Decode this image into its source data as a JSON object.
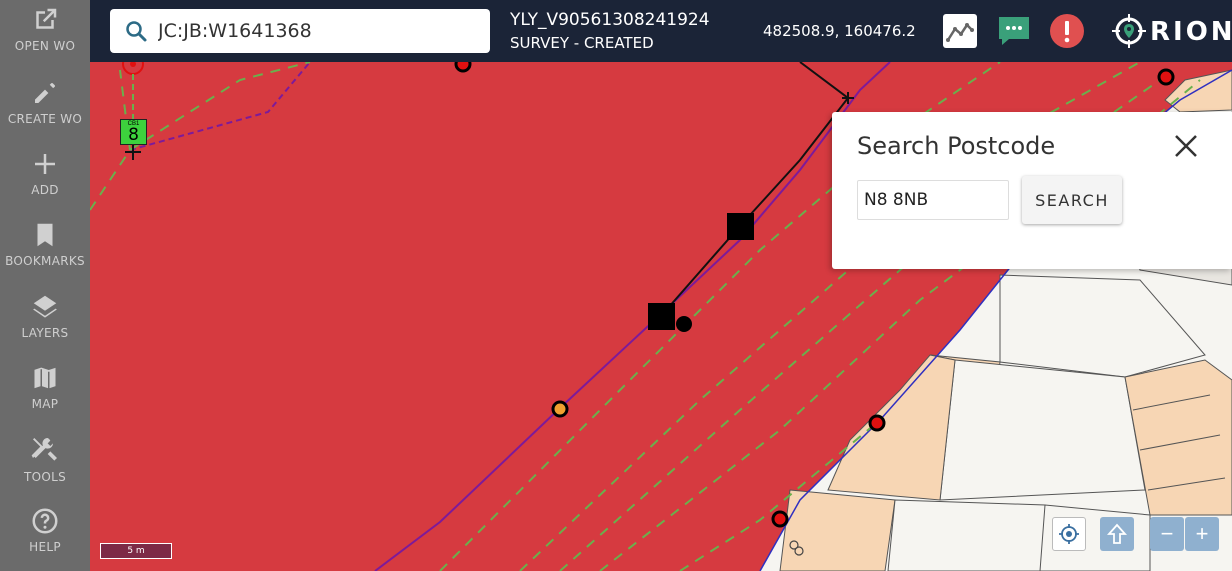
{
  "sidebar": {
    "items": [
      {
        "label": "OPEN WO",
        "icon": "open-external-icon"
      },
      {
        "label": "CREATE WO",
        "icon": "pencil-icon"
      },
      {
        "label": "ADD",
        "icon": "plus-icon"
      },
      {
        "label": "BOOKMARKS",
        "icon": "bookmark-icon"
      },
      {
        "label": "LAYERS",
        "icon": "layers-icon"
      },
      {
        "label": "MAP",
        "icon": "map-icon"
      },
      {
        "label": "TOOLS",
        "icon": "tools-icon"
      },
      {
        "label": "HELP",
        "icon": "help-icon"
      }
    ]
  },
  "header": {
    "search_value": "JC:JB:W1641368",
    "wo_title": "YLY_V90561308241924",
    "wo_status": "SURVEY - CREATED",
    "coordinates": "482508.9, 160476.2",
    "logo_text": "RION",
    "accent_teal": "#3aa07a",
    "alert_red": "#e05050"
  },
  "postcode_panel": {
    "title": "Search Postcode",
    "input_value": "N8 8NB",
    "search_label": "SEARCH"
  },
  "map": {
    "marker_label": "8",
    "marker_small_label": "CB1",
    "scale_label": "5 m",
    "polygon_color": "#d63a40",
    "parcel_color": "#f7d6b4",
    "controls": {
      "zoom_out": "−",
      "zoom_in": "+"
    }
  }
}
